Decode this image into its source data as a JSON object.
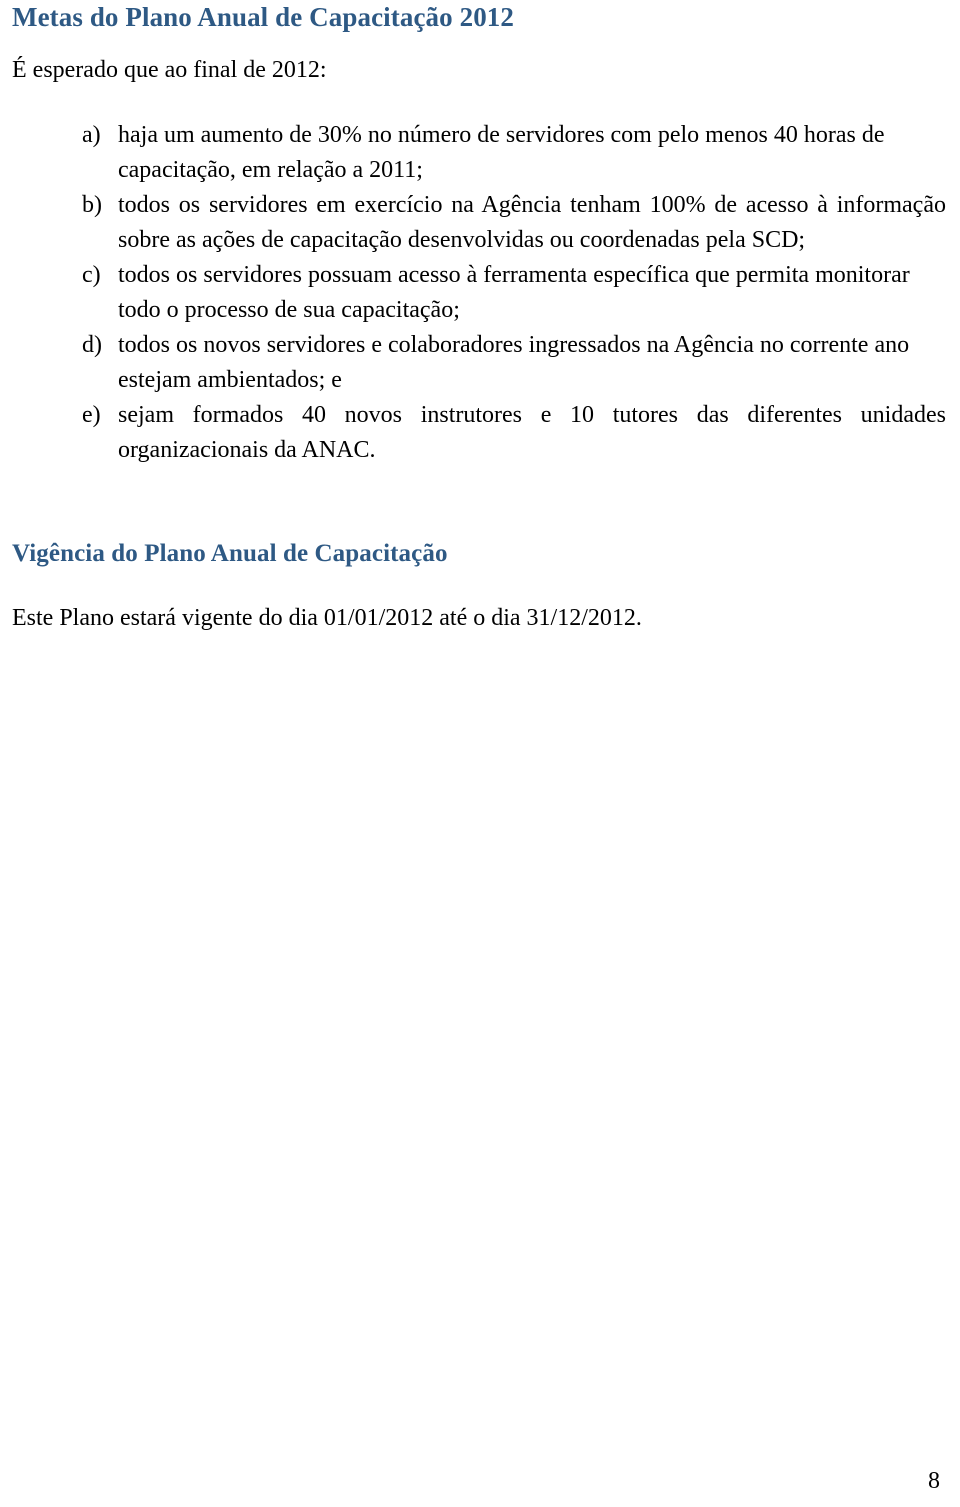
{
  "document": {
    "heading_1": "Metas do Plano Anual de Capacitação 2012",
    "intro": "É esperado que ao final de 2012:",
    "goals": [
      {
        "marker": "a)",
        "text": "haja um aumento de 30% no número de servidores com pelo menos 40 horas de capacitação, em relação a 2011;",
        "justified": false
      },
      {
        "marker": "b)",
        "text": "todos os servidores em exercício na Agência tenham 100% de acesso à informação sobre as ações de capacitação desenvolvidas ou coordenadas pela SCD;",
        "justified": true
      },
      {
        "marker": "c)",
        "text": "todos os servidores possuam acesso à ferramenta específica que permita monitorar todo o processo de sua capacitação;",
        "justified": false
      },
      {
        "marker": "d)",
        "text": "todos os novos servidores e colaboradores ingressados na Agência no corrente ano estejam ambientados; e",
        "justified": false
      },
      {
        "marker": "e)",
        "text": "sejam formados 40 novos instrutores e 10 tutores das diferentes unidades organizacionais da ANAC.",
        "justified": true
      }
    ],
    "heading_2": "Vigência do Plano Anual de Capacitação",
    "closing": "Este Plano estará vigente do dia 01/01/2012 até o dia 31/12/2012.",
    "page_number": "8"
  },
  "colors": {
    "heading_blue": "#2E5984",
    "body_black": "#000000",
    "page_background": "#ffffff"
  }
}
